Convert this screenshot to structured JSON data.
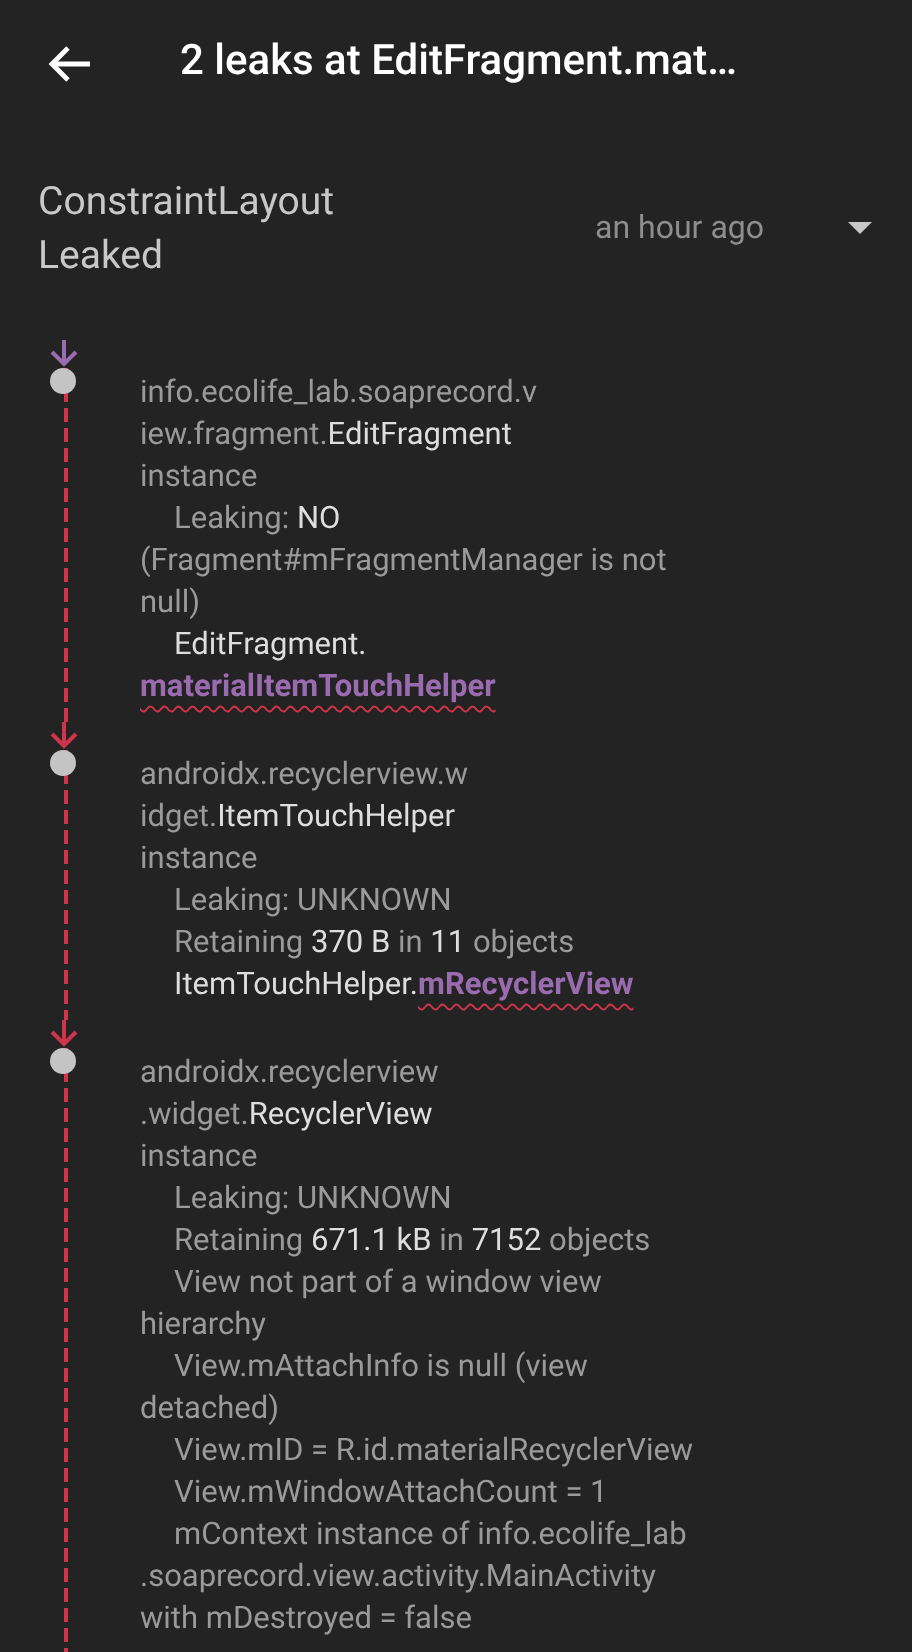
{
  "app_bar": {
    "title": "2 leaks at EditFragment.mat…"
  },
  "leak_header": {
    "title_lines": [
      "ConstraintLayout",
      "Leaked"
    ],
    "time": "an hour ago",
    "expanded": false
  },
  "trace": [
    {
      "color": "#9b6bb0",
      "lines": [
        {
          "kind": "plain",
          "indent": false,
          "text": "info.ecolife_lab.soaprecord.v"
        },
        {
          "kind": "plain",
          "indent": false,
          "text": "iew.fragment.**EditFragment**"
        },
        {
          "kind": "plain",
          "indent": false,
          "text": "instance"
        },
        {
          "kind": "plain",
          "indent": true,
          "text": "Leaking: **NO**"
        },
        {
          "kind": "plain",
          "indent": false,
          "text": "(Fragment#mFragmentManager is not"
        },
        {
          "kind": "plain",
          "indent": false,
          "text": "null)"
        },
        {
          "kind": "plain",
          "indent": true,
          "text": "**EditFragment.**"
        },
        {
          "kind": "ref",
          "indent": false,
          "field": "materialItemTouchHelper"
        }
      ]
    },
    {
      "color": "#d0344a",
      "lines": [
        {
          "kind": "plain",
          "indent": false,
          "text": "androidx.recyclerview.w"
        },
        {
          "kind": "plain",
          "indent": false,
          "text": "idget.**ItemTouchHelper**"
        },
        {
          "kind": "plain",
          "indent": false,
          "text": "instance"
        },
        {
          "kind": "plain",
          "indent": true,
          "text": "Leaking: UNKNOWN"
        },
        {
          "kind": "plain",
          "indent": true,
          "text": "Retaining **370 B** in **11** objects"
        },
        {
          "kind": "ref",
          "indent": true,
          "owner": "ItemTouchHelper.",
          "field": "mRecyclerView"
        }
      ]
    },
    {
      "color": "#d0344a",
      "lines": [
        {
          "kind": "plain",
          "indent": false,
          "text": "androidx.recyclerview"
        },
        {
          "kind": "plain",
          "indent": false,
          "text": ".widget.**RecyclerView**"
        },
        {
          "kind": "plain",
          "indent": false,
          "text": "instance"
        },
        {
          "kind": "plain",
          "indent": true,
          "text": "Leaking: UNKNOWN"
        },
        {
          "kind": "plain",
          "indent": true,
          "text": "Retaining **671.1 kB** in **7152** objects"
        },
        {
          "kind": "plain",
          "indent": true,
          "text": "View not part of a window view"
        },
        {
          "kind": "plain",
          "indent": false,
          "text": "hierarchy"
        },
        {
          "kind": "plain",
          "indent": true,
          "text": "View.mAttachInfo is null (view"
        },
        {
          "kind": "plain",
          "indent": false,
          "text": "detached)"
        },
        {
          "kind": "plain",
          "indent": true,
          "text": "View.mID = R.id.materialRecyclerView"
        },
        {
          "kind": "plain",
          "indent": true,
          "text": "View.mWindowAttachCount = 1"
        },
        {
          "kind": "plain",
          "indent": true,
          "text": "mContext instance of info.ecolife_lab"
        },
        {
          "kind": "plain",
          "indent": false,
          "text": ".soaprecord.view.activity.MainActivity"
        },
        {
          "kind": "plain",
          "indent": false,
          "text": "with mDestroyed = false"
        }
      ]
    }
  ]
}
